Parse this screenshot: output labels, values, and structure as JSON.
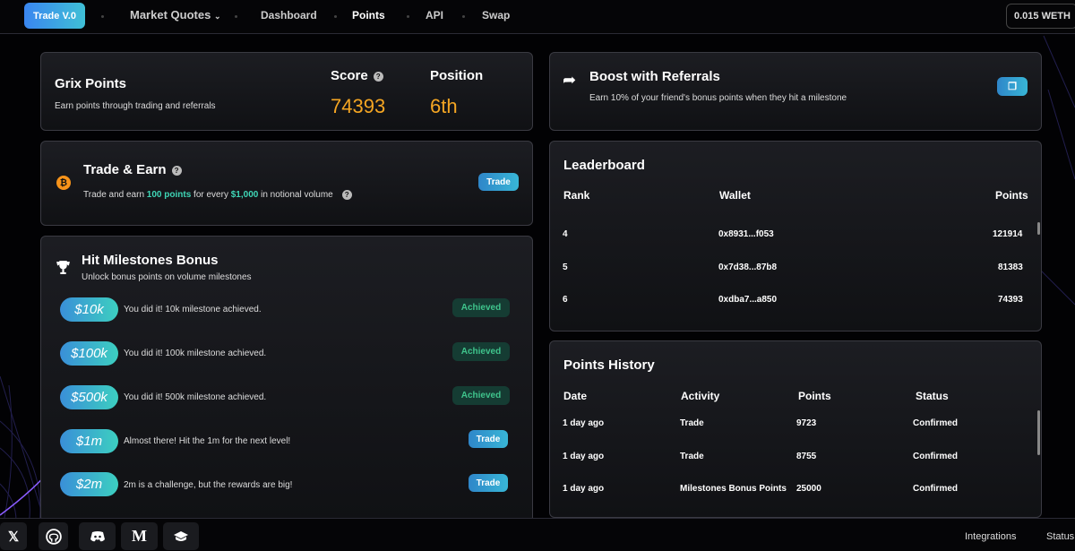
{
  "nav": {
    "brand": "Trade V.0",
    "market": "Market Quotes",
    "dashboard": "Dashboard",
    "points": "Points",
    "api": "API",
    "swap": "Swap",
    "wallet": "0.015 WETH"
  },
  "grix": {
    "title": "Grix Points",
    "subtitle": "Earn points through trading and referrals",
    "score_label": "Score",
    "score_value": "74393",
    "position_label": "Position",
    "position_value": "6th"
  },
  "trade_earn": {
    "title": "Trade & Earn",
    "pre": "Trade and earn ",
    "points": "100 points",
    "mid": " for every ",
    "amount": "$1,000",
    "post": " in notional volume",
    "button": "Trade"
  },
  "milestones": {
    "title": "Hit Milestones Bonus",
    "subtitle": "Unlock bonus points on volume milestones",
    "items": [
      {
        "amount": "$10k",
        "text": "You did it! 10k milestone achieved.",
        "status": "Achieved"
      },
      {
        "amount": "$100k",
        "text": "You did it! 100k milestone achieved.",
        "status": "Achieved"
      },
      {
        "amount": "$500k",
        "text": "You did it! 500k milestone achieved.",
        "status": "Achieved"
      },
      {
        "amount": "$1m",
        "text": "Almost there! Hit the 1m for the next level!",
        "status": "Trade"
      },
      {
        "amount": "$2m",
        "text": "2m is a challenge, but the rewards are big!",
        "status": "Trade"
      }
    ]
  },
  "referrals": {
    "title": "Boost with Referrals",
    "subtitle": "Earn 10% of your friend's bonus points when they hit a milestone"
  },
  "leaderboard": {
    "title": "Leaderboard",
    "headers": [
      "Rank",
      "Wallet",
      "Points"
    ],
    "rows": [
      [
        "4",
        "0x8931...f053",
        "121914"
      ],
      [
        "5",
        "0x7d38...87b8",
        "81383"
      ],
      [
        "6",
        "0xdba7...a850",
        "74393"
      ]
    ]
  },
  "history": {
    "title": "Points History",
    "headers": [
      "Date",
      "Activity",
      "Points",
      "Status"
    ],
    "rows": [
      [
        "1 day ago",
        "Trade",
        "9723",
        "Confirmed"
      ],
      [
        "1 day ago",
        "Trade",
        "8755",
        "Confirmed"
      ],
      [
        "1 day ago",
        "Milestones Bonus Points",
        "25000",
        "Confirmed"
      ]
    ]
  },
  "footer": {
    "integrations": "Integrations",
    "status": "Status"
  },
  "colors": {
    "accent": "#3a86f0",
    "score": "#f5a623",
    "success": "#3fc48c"
  },
  "icons": [
    "x-icon",
    "github-icon",
    "discord-icon",
    "medium-icon",
    "docs-icon",
    "bitcoin-icon",
    "trophy-icon",
    "share-icon",
    "copy-icon",
    "question-icon"
  ]
}
